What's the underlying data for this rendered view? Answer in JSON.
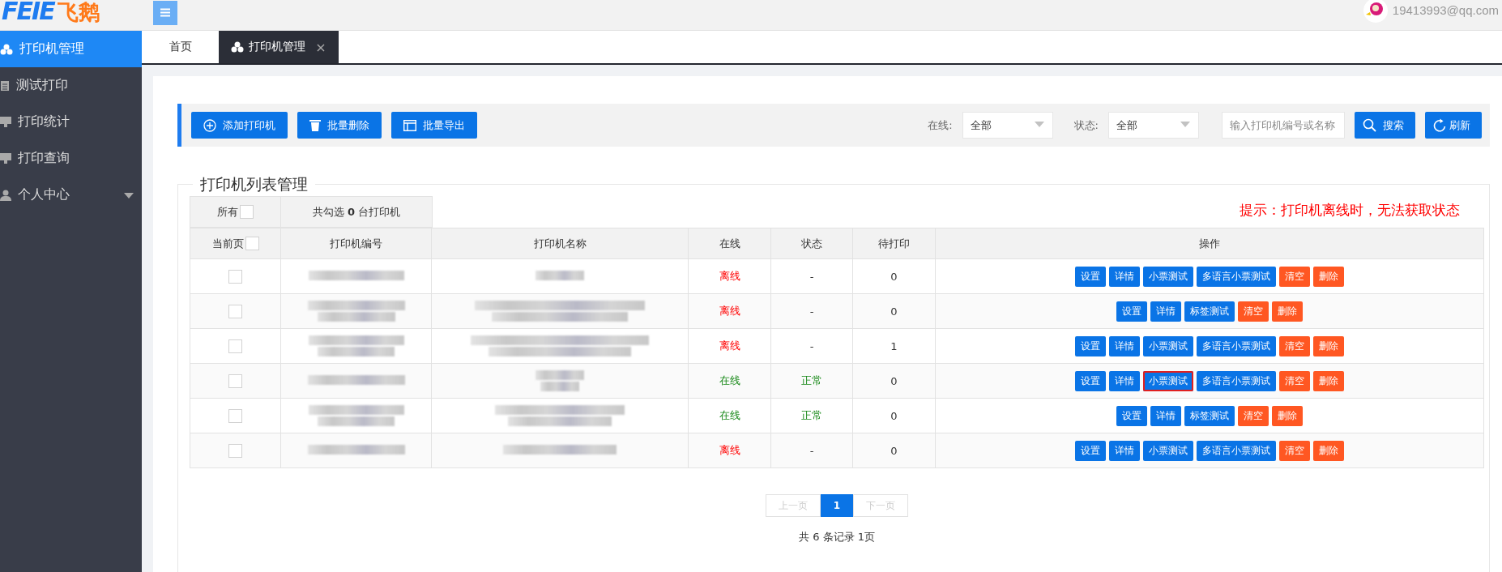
{
  "logo": {
    "latin": "FEIE",
    "cjk": "飞鹅"
  },
  "header": {
    "user_email": "19413993@qq.com"
  },
  "sidebar": {
    "items": [
      {
        "label": "打印机管理",
        "selected": true,
        "has_submenu": false
      },
      {
        "label": "测试打印",
        "selected": false,
        "has_submenu": false
      },
      {
        "label": "打印统计",
        "selected": false,
        "has_submenu": false
      },
      {
        "label": "打印查询",
        "selected": false,
        "has_submenu": false
      },
      {
        "label": "个人中心",
        "selected": false,
        "has_submenu": true
      }
    ]
  },
  "tabs": [
    {
      "label": "首页",
      "selected": false
    },
    {
      "label": "打印机管理",
      "selected": true,
      "close": "×"
    }
  ],
  "toolbar": {
    "buttons": [
      {
        "label": "添加打印机",
        "kind": "add"
      },
      {
        "label": "批量删除",
        "kind": "delete"
      },
      {
        "label": "批量导出",
        "kind": "export"
      }
    ],
    "filters": [
      {
        "label": "在线:",
        "value": "全部"
      },
      {
        "label": "状态:",
        "value": "全部"
      }
    ],
    "search": {
      "placeholder": "输入打印机编号或名称"
    },
    "search_button": "搜索",
    "refresh_button": "刷新"
  },
  "panel": {
    "title": "打印机列表管理",
    "notice": "提示：打印机离线时，无法获取状态"
  },
  "table": {
    "select_all": {
      "label": "所有",
      "checked": false
    },
    "select_page": {
      "label": "当前页",
      "checked": false
    },
    "selection_summary": "共勾选 **0** 台打印机",
    "columns": [
      "打印机编号",
      "打印机名称",
      "在线",
      "状态",
      "待打印",
      "操作"
    ],
    "rows": [
      {
        "checked": false,
        "online": false,
        "online_text": "离线",
        "status": "-",
        "pending": "0",
        "actions": [
          {
            "label": "设置",
            "kind": "primary",
            "highlighted": false
          },
          {
            "label": "详情",
            "kind": "primary",
            "highlighted": false
          },
          {
            "label": "小票测试",
            "kind": "primary",
            "highlighted": false
          },
          {
            "label": "多语言小票测试",
            "kind": "primary",
            "highlighted": false
          },
          {
            "label": "清空",
            "kind": "danger",
            "highlighted": false
          },
          {
            "label": "删除",
            "kind": "danger",
            "highlighted": false
          }
        ]
      },
      {
        "checked": false,
        "online": false,
        "online_text": "离线",
        "status": "-",
        "pending": "0",
        "actions": [
          {
            "label": "设置",
            "kind": "primary",
            "highlighted": false
          },
          {
            "label": "详情",
            "kind": "primary",
            "highlighted": false
          },
          {
            "label": "标签测试",
            "kind": "primary",
            "highlighted": false
          },
          {
            "label": "清空",
            "kind": "danger",
            "highlighted": false
          },
          {
            "label": "删除",
            "kind": "danger",
            "highlighted": false
          }
        ]
      },
      {
        "checked": false,
        "online": false,
        "online_text": "离线",
        "status": "-",
        "pending": "1",
        "actions": [
          {
            "label": "设置",
            "kind": "primary",
            "highlighted": false
          },
          {
            "label": "详情",
            "kind": "primary",
            "highlighted": false
          },
          {
            "label": "小票测试",
            "kind": "primary",
            "highlighted": false
          },
          {
            "label": "多语言小票测试",
            "kind": "primary",
            "highlighted": false
          },
          {
            "label": "清空",
            "kind": "danger",
            "highlighted": false
          },
          {
            "label": "删除",
            "kind": "danger",
            "highlighted": false
          }
        ]
      },
      {
        "checked": false,
        "online": true,
        "online_text": "在线",
        "status": "正常",
        "pending": "0",
        "actions": [
          {
            "label": "设置",
            "kind": "primary",
            "highlighted": false
          },
          {
            "label": "详情",
            "kind": "primary",
            "highlighted": false
          },
          {
            "label": "小票测试",
            "kind": "primary",
            "highlighted": true
          },
          {
            "label": "多语言小票测试",
            "kind": "primary",
            "highlighted": false
          },
          {
            "label": "清空",
            "kind": "danger",
            "highlighted": false
          },
          {
            "label": "删除",
            "kind": "danger",
            "highlighted": false
          }
        ]
      },
      {
        "checked": false,
        "online": true,
        "online_text": "在线",
        "status": "正常",
        "pending": "0",
        "actions": [
          {
            "label": "设置",
            "kind": "primary",
            "highlighted": false
          },
          {
            "label": "详情",
            "kind": "primary",
            "highlighted": false
          },
          {
            "label": "标签测试",
            "kind": "primary",
            "highlighted": false
          },
          {
            "label": "清空",
            "kind": "danger",
            "highlighted": false
          },
          {
            "label": "删除",
            "kind": "danger",
            "highlighted": false
          }
        ]
      },
      {
        "checked": false,
        "online": false,
        "online_text": "离线",
        "status": "-",
        "pending": "0",
        "actions": [
          {
            "label": "设置",
            "kind": "primary",
            "highlighted": false
          },
          {
            "label": "详情",
            "kind": "primary",
            "highlighted": false
          },
          {
            "label": "小票测试",
            "kind": "primary",
            "highlighted": false
          },
          {
            "label": "多语言小票测试",
            "kind": "primary",
            "highlighted": false
          },
          {
            "label": "清空",
            "kind": "danger",
            "highlighted": false
          },
          {
            "label": "删除",
            "kind": "danger",
            "highlighted": false
          }
        ]
      }
    ]
  },
  "pagination": {
    "prev": "上一页",
    "pages": [
      {
        "label": "1",
        "selected": true
      }
    ],
    "next": "下一页",
    "summary": "共 6 条记录 1页"
  }
}
